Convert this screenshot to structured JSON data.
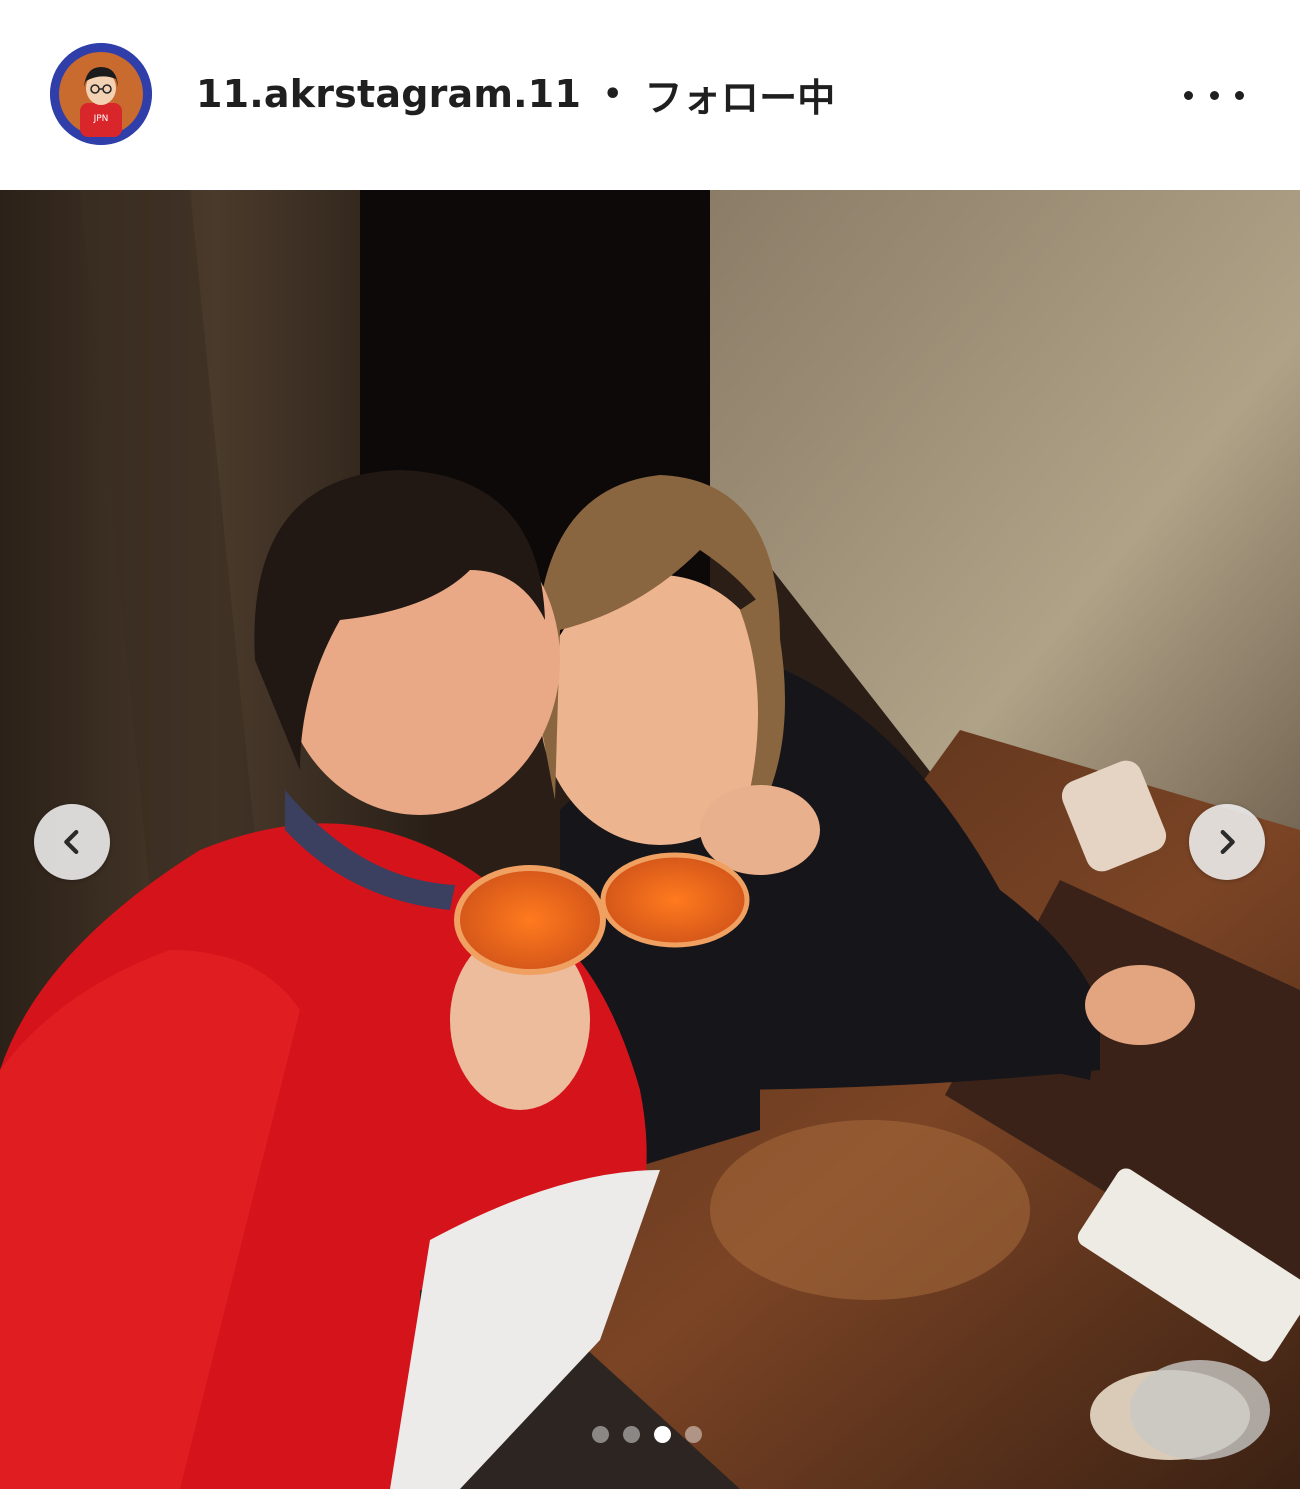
{
  "header": {
    "username": "11.akrstagram.11",
    "separator": "•",
    "follow_status": "フォロー中",
    "more_icon": "more-horizontal-icon"
  },
  "avatar": {
    "icon": "illustrated-avatar",
    "ring_color": "#2f3ea8",
    "inner_color": "#c96a2e",
    "shirt_text": "JPN"
  },
  "post": {
    "media_type": "photo",
    "carousel": {
      "prev_icon": "chevron-left-icon",
      "next_icon": "chevron-right-icon",
      "total_slides": 4,
      "active_slide": 3
    }
  }
}
